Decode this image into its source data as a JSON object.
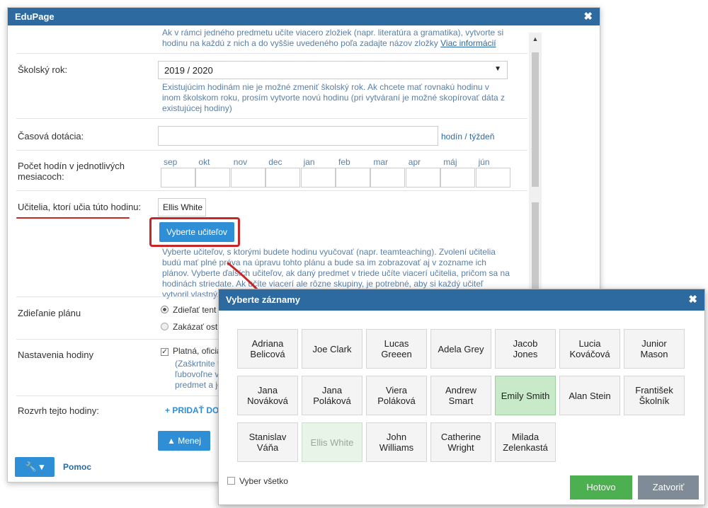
{
  "main": {
    "title": "EduPage",
    "folder_hint": "Ak v rámci jedného predmetu učíte viacero zložiek (napr. literatúra a gramatika), vytvorte si hodinu na každú z nich a do vyššie uvedeného poľa zadajte názov zložky",
    "folder_hint_link": "Viac informácií",
    "school_year": {
      "label": "Školský rok:",
      "value": "2019 / 2020",
      "hint": "Existujúcim hodinám nie je možné zmeniť školský rok. Ak chcete mať rovnakú hodinu v inom školskom roku, prosím vytvorte novú hodinu (pri vytváraní je možné skopírovať dáta z existujúcej hodiny)"
    },
    "time_allocation": {
      "label": "Časová dotácia:",
      "value": "",
      "unit": "hodín / týždeň"
    },
    "monthly_hours": {
      "label": "Počet hodín v jednotlivých mesiacoch:",
      "months": [
        "sep",
        "okt",
        "nov",
        "dec",
        "jan",
        "feb",
        "mar",
        "apr",
        "máj",
        "jún"
      ]
    },
    "teachers": {
      "label": "Učitelia, ktorí učia túto hodinu:",
      "selected": "Ellis White",
      "button": "Vyberte učiteľov",
      "hint": "Vyberte učiteľov, s ktorými budete hodinu vyučovať (napr. teamteaching). Zvolení učitelia budú mať plné práva na úpravu tohto plánu a bude sa im zobrazovať aj v zozname ich plánov. Vyberte ďalších učiteľov, ak daný predmet v triede učíte viacerí učitelia, pričom sa na hodinách striedate. Ak učíte viacerí ale rôzne skupiny, je potrebné, aby si každý učiteľ vytvoril vlastný plán."
    },
    "sharing": {
      "label": "Zdieľanie plánu",
      "option1": "Zdieľať tent",
      "option2": "Zakázať ost"
    },
    "settings": {
      "label": "Nastavenia hodiny",
      "checkbox": "Platná, oficiá",
      "hint": "(Zaškrtnite t\nľubovoľne v\npredmet a je"
    },
    "schedule": {
      "label": "Rozvrh tejto hodiny:",
      "add": "+ PRIDAŤ DO"
    },
    "less_button": "▲  Menej",
    "help": "Pomoc",
    "tool_button": "🔧 ▾"
  },
  "popup": {
    "title": "Vyberte záznamy",
    "teachers": [
      {
        "name": "Adriana\nBelicová",
        "state": "normal"
      },
      {
        "name": "Joe Clark",
        "state": "normal"
      },
      {
        "name": "Lucas\nGreeen",
        "state": "normal"
      },
      {
        "name": "Adela Grey",
        "state": "normal"
      },
      {
        "name": "Jacob\nJones",
        "state": "normal"
      },
      {
        "name": "Lucia\nKováčová",
        "state": "normal"
      },
      {
        "name": "Junior\nMason",
        "state": "normal"
      },
      {
        "name": "Jana\nNováková",
        "state": "normal"
      },
      {
        "name": "Jana\nPoláková",
        "state": "normal"
      },
      {
        "name": "Viera\nPoláková",
        "state": "normal"
      },
      {
        "name": "Andrew\nSmart",
        "state": "normal"
      },
      {
        "name": "Emily Smith",
        "state": "selected"
      },
      {
        "name": "Alan Stein",
        "state": "normal"
      },
      {
        "name": "František\nŠkolník",
        "state": "normal"
      },
      {
        "name": "Stanislav\nVáňa",
        "state": "normal"
      },
      {
        "name": "Ellis White",
        "state": "disabled"
      },
      {
        "name": "John\nWilliams",
        "state": "normal"
      },
      {
        "name": "Catherine\nWright",
        "state": "normal"
      },
      {
        "name": "Milada\nZelenkastá",
        "state": "normal"
      }
    ],
    "select_all": "Vyber všetko",
    "done": "Hotovo",
    "close": "Zatvoriť"
  },
  "colors": {
    "accent": "#2c6aa0",
    "button_blue": "#2e8fd6",
    "done_green": "#4caf50",
    "close_gray": "#7f8c97",
    "annotation_red": "#c62828",
    "selected_tile": "#c9eac9"
  }
}
